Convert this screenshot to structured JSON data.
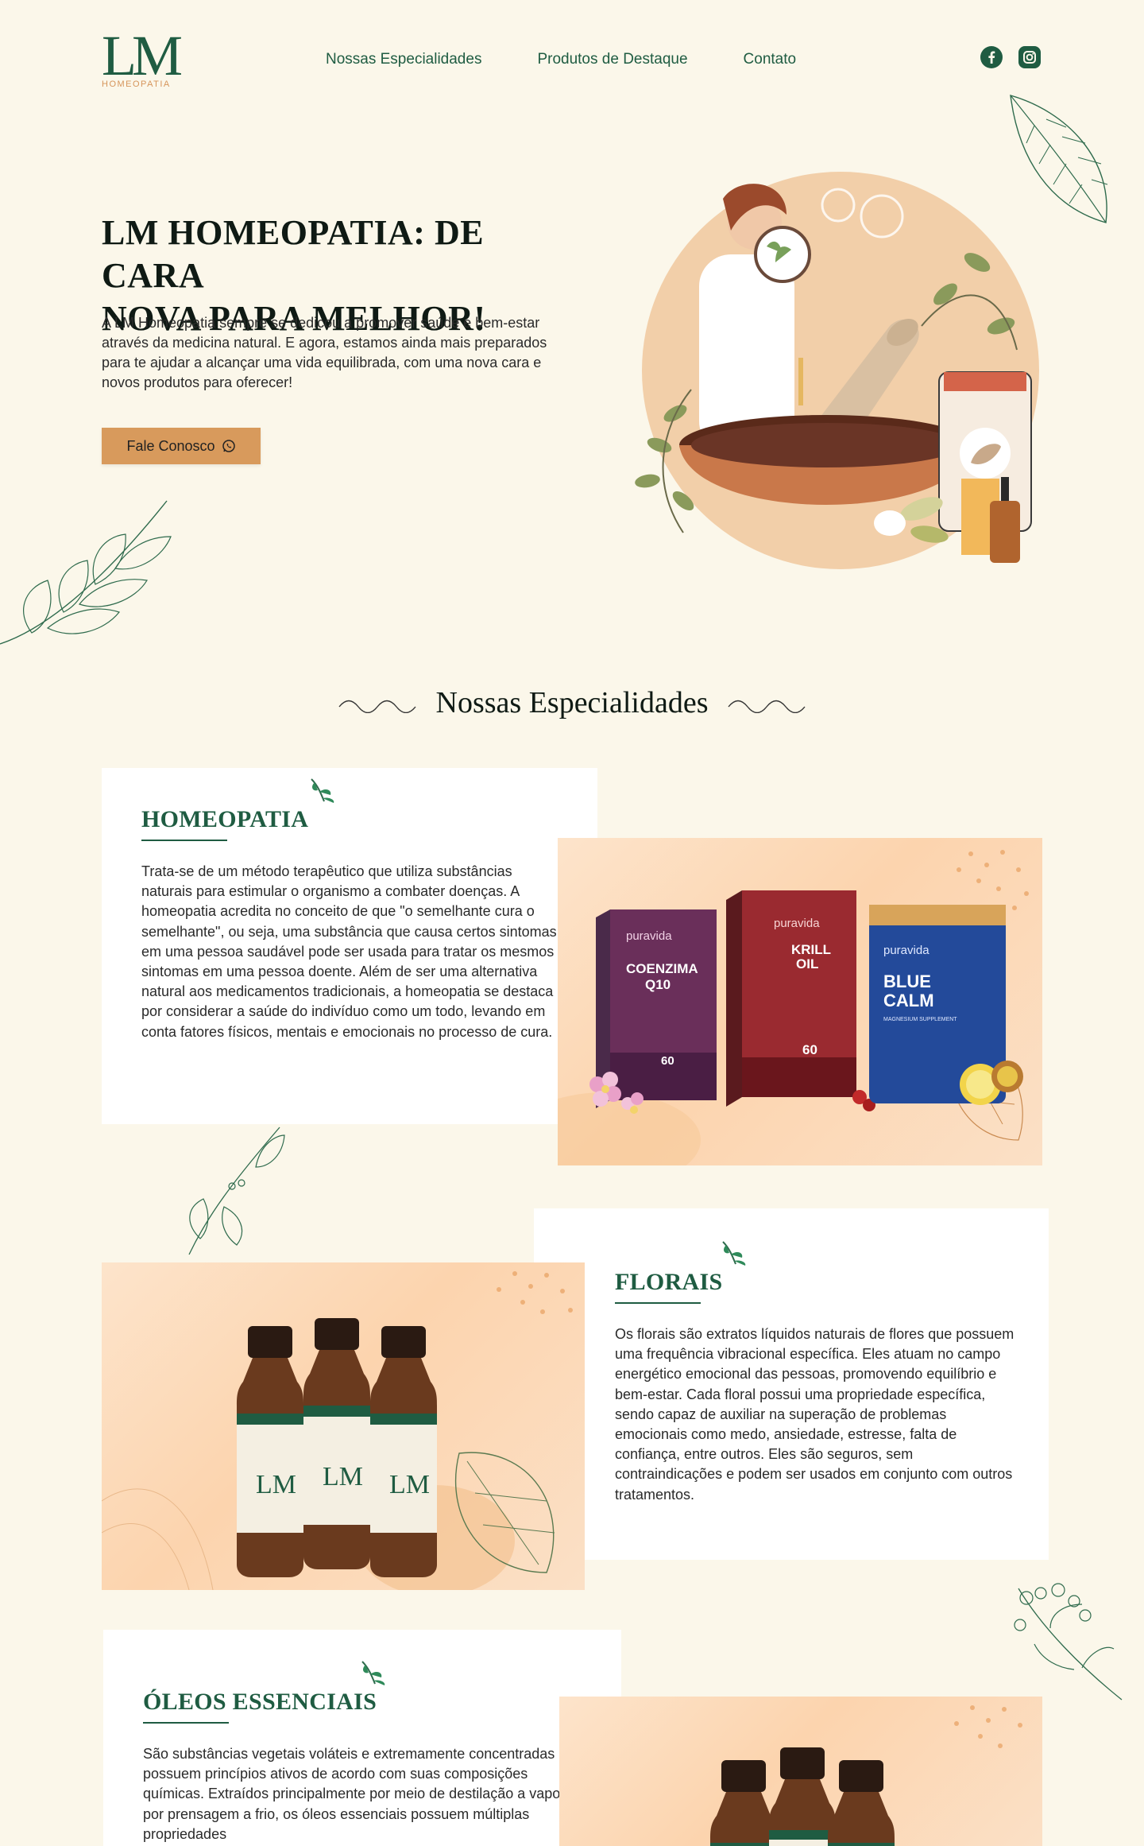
{
  "header": {
    "logo_text": "LM",
    "logo_sub": "HOMEOPATIA",
    "nav": [
      "Nossas Especialidades",
      "Produtos de Destaque",
      "Contato"
    ],
    "social": [
      "facebook-icon",
      "instagram-icon"
    ]
  },
  "hero": {
    "title_line1": "LM HOMEOPATIA: DE CARA",
    "title_line2": "NOVA PARA MELHOR!",
    "text": "A LM Homeopatia sempre se dedicou a promover saúde e bem-estar através da medicina natural. E agora, estamos ainda mais preparados para te ajudar a alcançar uma vida equilibrada, com uma nova cara e novos produtos para oferecer!",
    "cta_label": "Fale Conosco"
  },
  "specialties": {
    "title": "Nossas Especialidades",
    "items": [
      {
        "title": "HOMEOPATIA",
        "text": "Trata-se de um método terapêutico que utiliza substâncias naturais para estimular o organismo a combater doenças. A homeopatia acredita no conceito de que \"o semelhante cura o semelhante\", ou seja, uma substância que causa certos sintomas em uma pessoa saudável pode ser usada para tratar os mesmos sintomas em uma pessoa doente. Além de ser uma alternativa natural aos medicamentos tradicionais, a homeopatia se destaca por considerar a saúde do indivíduo como um todo, levando em conta fatores físicos, mentais e emocionais no processo de cura."
      },
      {
        "title": "FLORAIS",
        "text": "Os florais são extratos líquidos naturais de flores que possuem uma frequência vibracional específica. Eles atuam no campo energético emocional das pessoas, promovendo equilíbrio e bem-estar. Cada floral possui uma propriedade específica, sendo capaz de auxiliar na superação de problemas emocionais como medo, ansiedade, estresse, falta de confiança, entre outros. Eles são seguros, sem contraindicações e podem ser usados em conjunto com outros tratamentos."
      },
      {
        "title": "ÓLEOS ESSENCIAIS",
        "text": "São substâncias vegetais voláteis e extremamente concentradas que possuem princípios ativos de acordo com suas composições químicas. Extraídos principalmente por meio de destilação a vapor ou por prensagem a frio, os óleos essenciais possuem múltiplas propriedades"
      }
    ]
  },
  "products": {
    "brand": "puravida",
    "coenzima": "COENZIMA Q10",
    "coenzima_count": "60",
    "krill": "KRILL OIL",
    "krill_count": "60",
    "bluecalm": "BLUE CALM",
    "bluecalm_sub": "MAGNESIUM SUPPLEMENT",
    "bottle_label": "LM"
  },
  "colors": {
    "brand_green": "#1f5c42",
    "accent_orange": "#d89a5c",
    "background": "#fbf7ea"
  }
}
